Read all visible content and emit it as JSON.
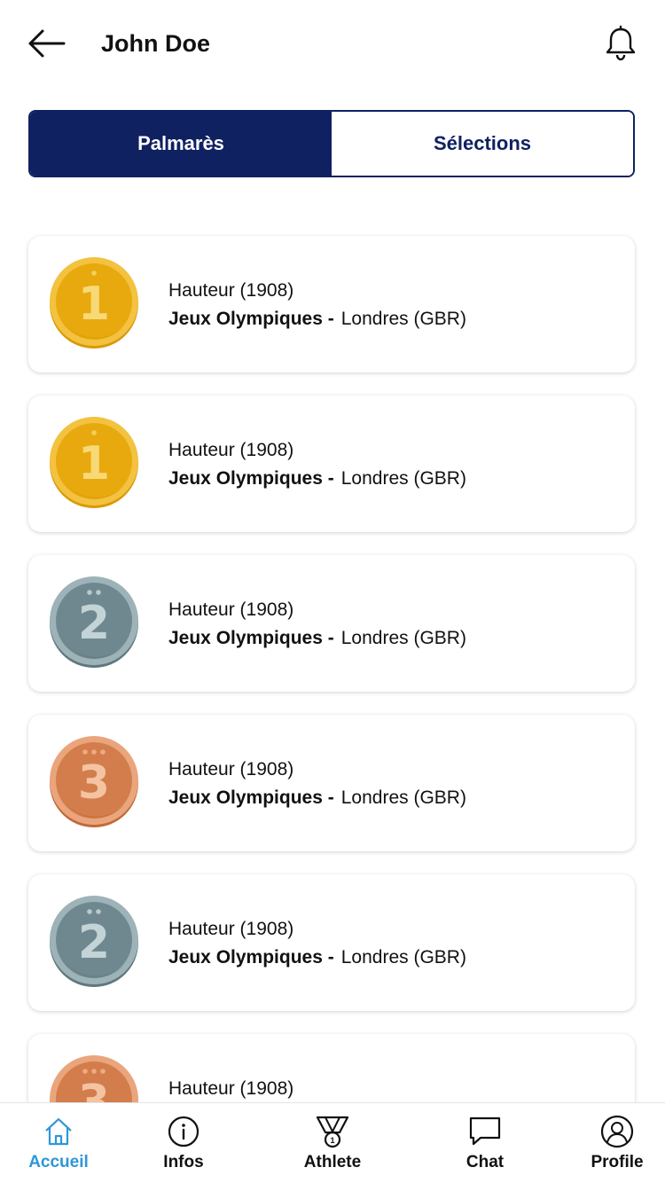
{
  "header": {
    "title": "John Doe",
    "back_icon": "arrow-left-icon",
    "notification_icon": "bell-icon"
  },
  "tabs": [
    {
      "label": "Palmarès",
      "active": true
    },
    {
      "label": "Sélections",
      "active": false
    }
  ],
  "results": [
    {
      "medal": "1",
      "medal_type": "gold",
      "event": "Hauteur (1908)",
      "competition": "Jeux Olympiques -",
      "location": "Londres (GBR)"
    },
    {
      "medal": "1",
      "medal_type": "gold",
      "event": "Hauteur (1908)",
      "competition": "Jeux Olympiques -",
      "location": "Londres (GBR)"
    },
    {
      "medal": "2",
      "medal_type": "silver",
      "event": "Hauteur (1908)",
      "competition": "Jeux Olympiques -",
      "location": "Londres (GBR)"
    },
    {
      "medal": "3",
      "medal_type": "bronze",
      "event": "Hauteur (1908)",
      "competition": "Jeux Olympiques -",
      "location": "Londres (GBR)"
    },
    {
      "medal": "2",
      "medal_type": "silver",
      "event": "Hauteur (1908)",
      "competition": "Jeux Olympiques -",
      "location": "Londres (GBR)"
    },
    {
      "medal": "3",
      "medal_type": "bronze",
      "event": "Hauteur (1908)",
      "competition": "",
      "location": ""
    }
  ],
  "nav": [
    {
      "label": "Accueil",
      "icon": "home-icon",
      "active": true
    },
    {
      "label": "Infos",
      "icon": "info-icon",
      "active": false
    },
    {
      "label": "Athlete",
      "icon": "medal-icon",
      "active": false
    },
    {
      "label": "Chat",
      "icon": "chat-icon",
      "active": false
    },
    {
      "label": "Profile",
      "icon": "profile-icon",
      "active": false
    }
  ],
  "colors": {
    "primary": "#0f2161",
    "nav_active": "#2e97d8",
    "gold": "#e8a90e",
    "silver": "#6f8890",
    "bronze": "#d37d4c"
  }
}
